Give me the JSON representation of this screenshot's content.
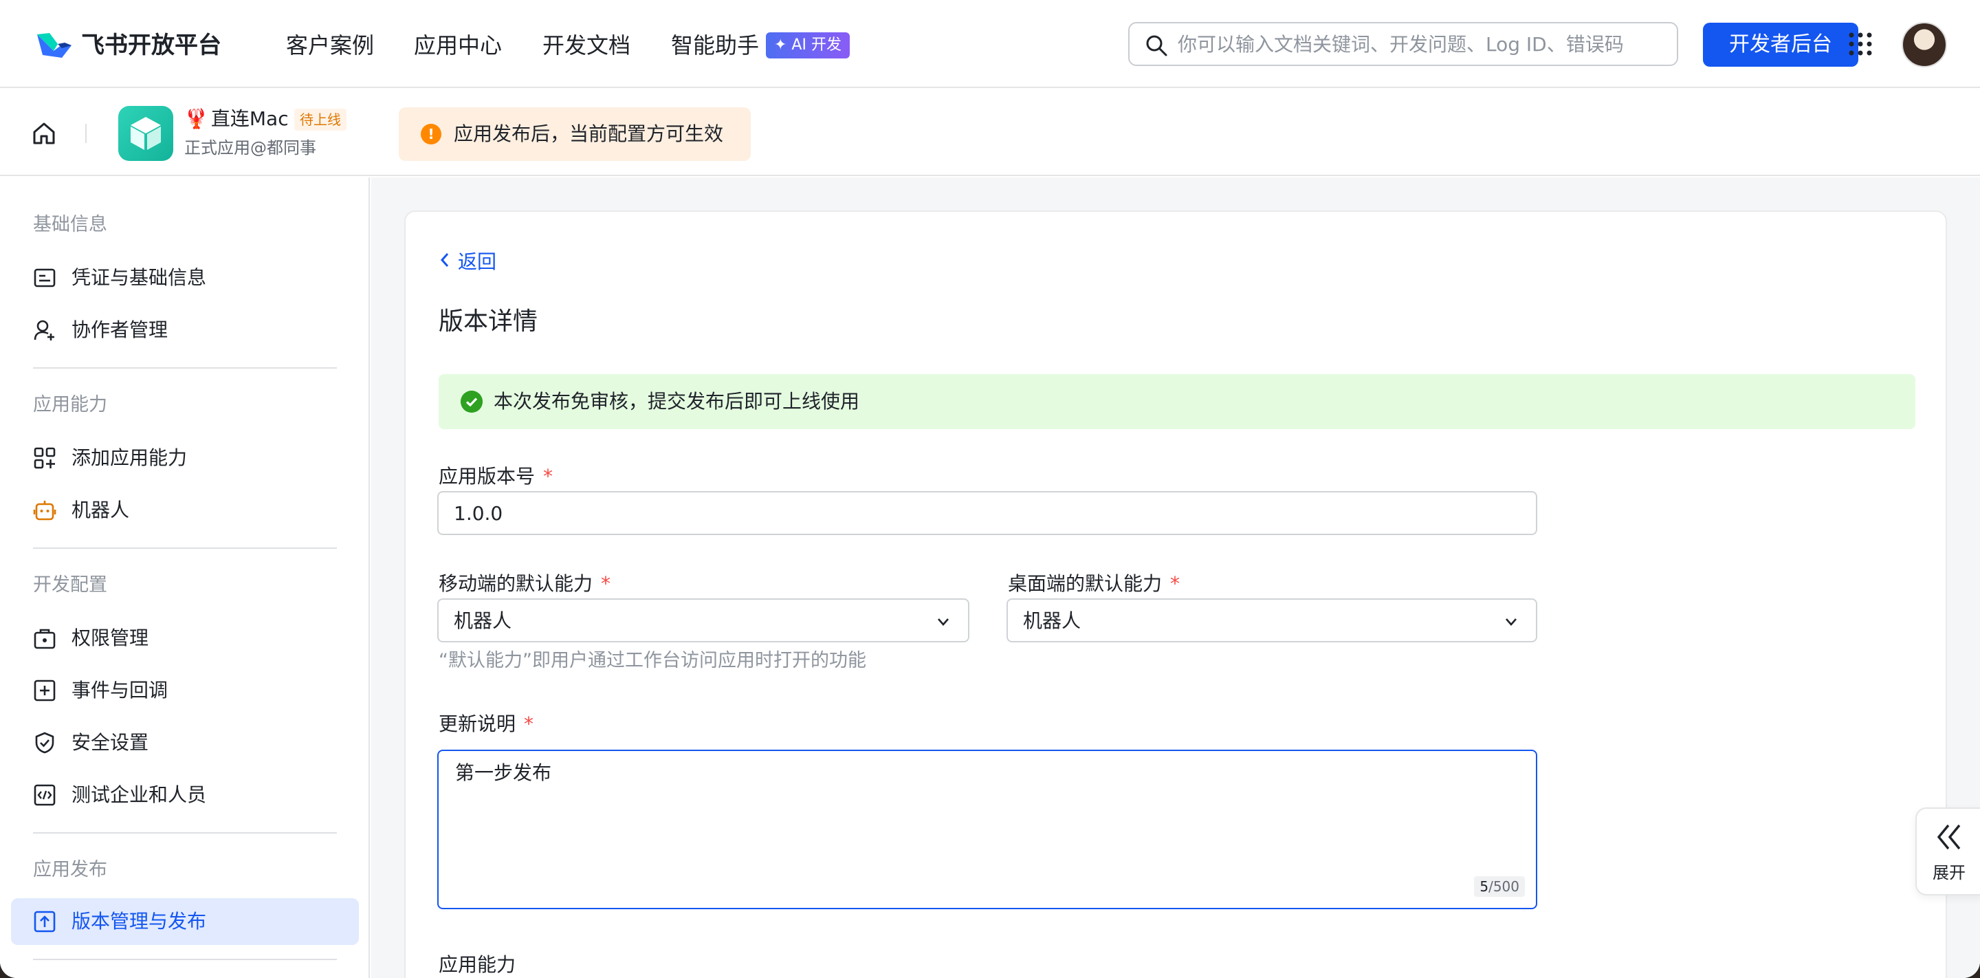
{
  "topnav": {
    "brand": "飞书开放平台",
    "links": [
      "客户案例",
      "应用中心",
      "开发文档",
      "智能助手"
    ],
    "ai_badge": "✦ AI 开发",
    "search_placeholder": "你可以输入文档关键词、开发问题、Log ID、错误码",
    "dev_console_label": "开发者后台"
  },
  "app_header": {
    "app_emoji": "🦞",
    "app_name": "直连Mac",
    "status": "待上线",
    "app_subtitle": "正式应用@都同事",
    "warning": "应用发布后，当前配置方可生效"
  },
  "sidebar": {
    "sections": [
      {
        "title": "基础信息",
        "items": [
          "凭证与基础信息",
          "协作者管理"
        ]
      },
      {
        "title": "应用能力",
        "items": [
          "添加应用能力",
          "机器人"
        ]
      },
      {
        "title": "开发配置",
        "items": [
          "权限管理",
          "事件与回调",
          "安全设置",
          "测试企业和人员"
        ]
      },
      {
        "title": "应用发布",
        "items": [
          "版本管理与发布"
        ]
      }
    ],
    "active_item": "版本管理与发布"
  },
  "main": {
    "back_label": "返回",
    "title": "版本详情",
    "success_banner": "本次发布免审核，提交发布后即可上线使用",
    "version_label": "应用版本号",
    "version_value": "1.0.0",
    "mobile_default_label": "移动端的默认能力",
    "mobile_default_value": "机器人",
    "desktop_default_label": "桌面端的默认能力",
    "desktop_default_value": "机器人",
    "default_hint": "“默认能力”即用户通过工作台访问应用时打开的功能",
    "notes_label": "更新说明",
    "notes_value": "第一步发布",
    "notes_count": "5",
    "notes_max": "/500",
    "capability_label": "应用能力",
    "required_mark": "*"
  },
  "expand_panel": {
    "label": "展开"
  },
  "colors": {
    "accent": "#1456f0",
    "success": "#2ea121",
    "warning": "#ff8800",
    "danger": "#f54a45"
  }
}
